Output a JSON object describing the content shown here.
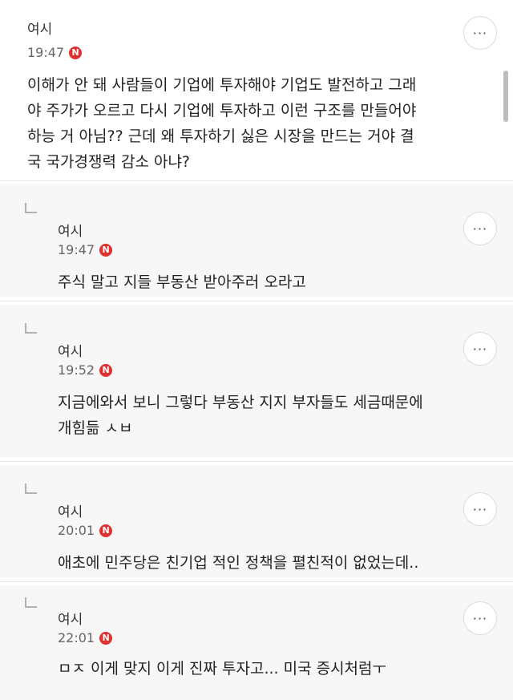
{
  "comments": [
    {
      "user": "여시",
      "time": "19:47",
      "badge": "N",
      "more": "···",
      "lines": [
        "이해가 안 돼 사람들이 기업에 투자해야 기업도 발전하고 그래",
        "야 주가가 오르고 다시 기업에 투자하고 이런 구조를 만들어야",
        "하능 거 아님?? 근데 왜 투자하기 싫은 시장을 만드는 거야 결",
        "국 국가경쟁력 감소 아냐?"
      ]
    }
  ],
  "replies": [
    {
      "user": "여시",
      "time": "19:47",
      "badge": "N",
      "more": "···",
      "lines": [
        "주식 말고 지들 부동산 받아주러 오라고"
      ]
    },
    {
      "user": "여시",
      "time": "19:52",
      "badge": "N",
      "more": "···",
      "lines": [
        "지금에와서 보니 그렇다 부동산 지지 부자들도 세금때문에",
        "개힘듦 ㅅㅂ"
      ]
    },
    {
      "user": "여시",
      "time": "20:01",
      "badge": "N",
      "more": "···",
      "lines": [
        "애초에 민주당은 친기업 적인 정책을 펼친적이 없었는데.."
      ]
    },
    {
      "user": "여시",
      "time": "22:01",
      "badge": "N",
      "more": "···",
      "lines": [
        "ㅁㅈ 이게 맞지 이게 진짜 투자고... 미국 증시처럼ㅜ"
      ]
    }
  ]
}
